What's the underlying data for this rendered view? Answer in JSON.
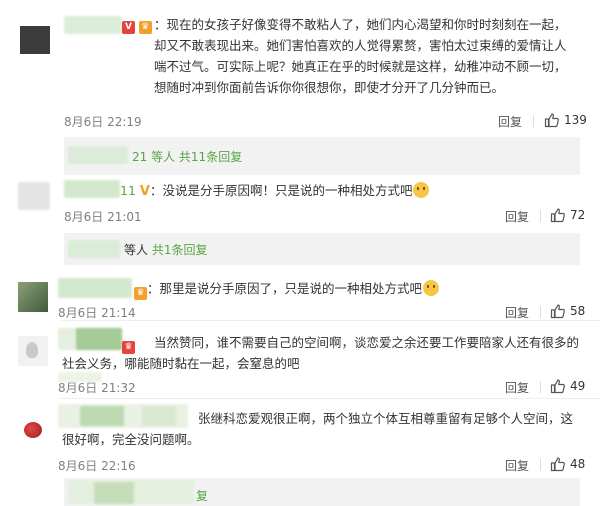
{
  "comments": [
    {
      "text": "：现在的女孩子好像变得不敢粘人了，她们内心渴望和你时时刻刻在一起，却又不敢表现出来。她们害怕喜欢的人觉得累赘，害怕太过束缚的爱情让人喘不过气。可实际上呢？她真正在乎的时候就是这样，幼稚冲动不顾一切，想随时冲到你面前告诉你你很想你，即使才分开了几分钟而已。",
      "time": "8月6日 22:19",
      "reply_label": "回复",
      "likes": "139"
    },
    {
      "text": "：没说是分手原因啊！只是说的一种相处方式吧",
      "time": "8月6日 21:01",
      "reply_label": "回复",
      "likes": "72"
    },
    {
      "text": "：那里是说分手原因了，只是说的一种相处方式吧",
      "time": "8月6日 21:14",
      "reply_label": "回复",
      "likes": "58"
    },
    {
      "text": "当然赞同，谁不需要自己的空间啊，谈恋爱之余还要工作要陪家人还有很多的社会义务，哪能随时黏在一起，会窒息的吧",
      "time": "8月6日 21:32",
      "reply_label": "回复",
      "likes": "49"
    },
    {
      "text": "张继科恋爱观很正啊，两个独立个体互相尊重留有足够个人空间，这很好啊，完全没问题啊。",
      "time": "8月6日 22:16",
      "reply_label": "回复",
      "likes": "48"
    }
  ],
  "reply_boxes": [
    {
      "count_prefix": "21 等人",
      "link": "共11条回复"
    },
    {
      "count_prefix": "等人",
      "link": "共1条回复"
    },
    {
      "count_prefix": "",
      "link": "复"
    }
  ],
  "user_fragments": {
    "c2_name_tail": "11",
    "c2_badge": "V"
  },
  "colors": {
    "link_green": "#57a545",
    "like_icon": "#555555",
    "reply_bg": "#f2f2f2"
  }
}
